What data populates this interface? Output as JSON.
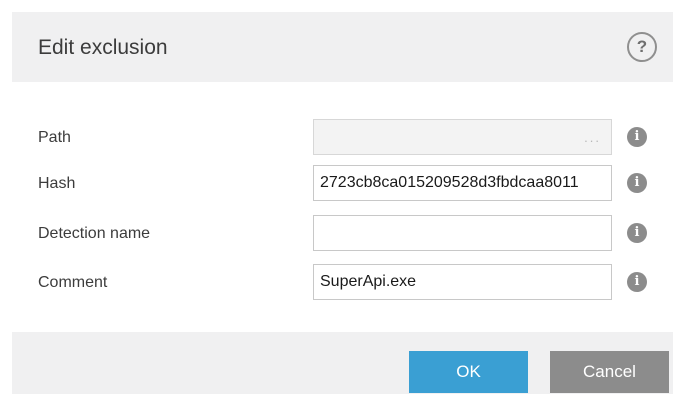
{
  "dialog": {
    "title": "Edit exclusion",
    "help_label": "?"
  },
  "form": {
    "fields": [
      {
        "label": "Path",
        "value": "",
        "browse_label": "...",
        "disabled": true
      },
      {
        "label": "Hash",
        "value": "2723cb8ca015209528d3fbdcaa8011"
      },
      {
        "label": "Detection name",
        "value": ""
      },
      {
        "label": "Comment",
        "value": "SuperApi.exe"
      }
    ],
    "info_glyph": "i"
  },
  "footer": {
    "ok_label": "OK",
    "cancel_label": "Cancel"
  },
  "colors": {
    "accent": "#3a9fd3",
    "secondary_button": "#8c8c8c",
    "panel_background": "#f0f0f1"
  },
  "icons": {
    "help": "question-circle-icon",
    "info": "info-icon",
    "browse": "ellipsis-icon"
  }
}
